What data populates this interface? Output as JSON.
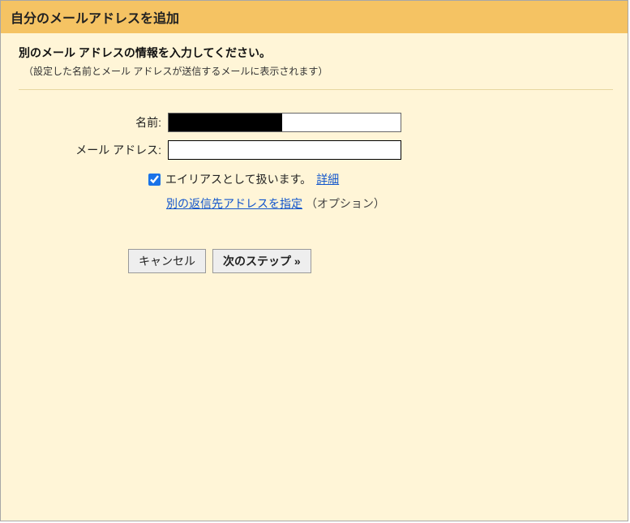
{
  "titlebar": "自分のメールアドレスを追加",
  "heading": "別のメール アドレスの情報を入力してください。",
  "subheading": "（設定した名前とメール アドレスが送信するメールに表示されます）",
  "form": {
    "name_label": "名前:",
    "name_value": "",
    "email_label": "メール アドレス:",
    "email_value": ""
  },
  "alias": {
    "checked": true,
    "label": "エイリアスとして扱います。",
    "details_link": "詳細"
  },
  "reply": {
    "link": "別の返信先アドレスを指定",
    "optional": "（オプション）"
  },
  "buttons": {
    "cancel": "キャンセル",
    "next": "次のステップ »"
  }
}
